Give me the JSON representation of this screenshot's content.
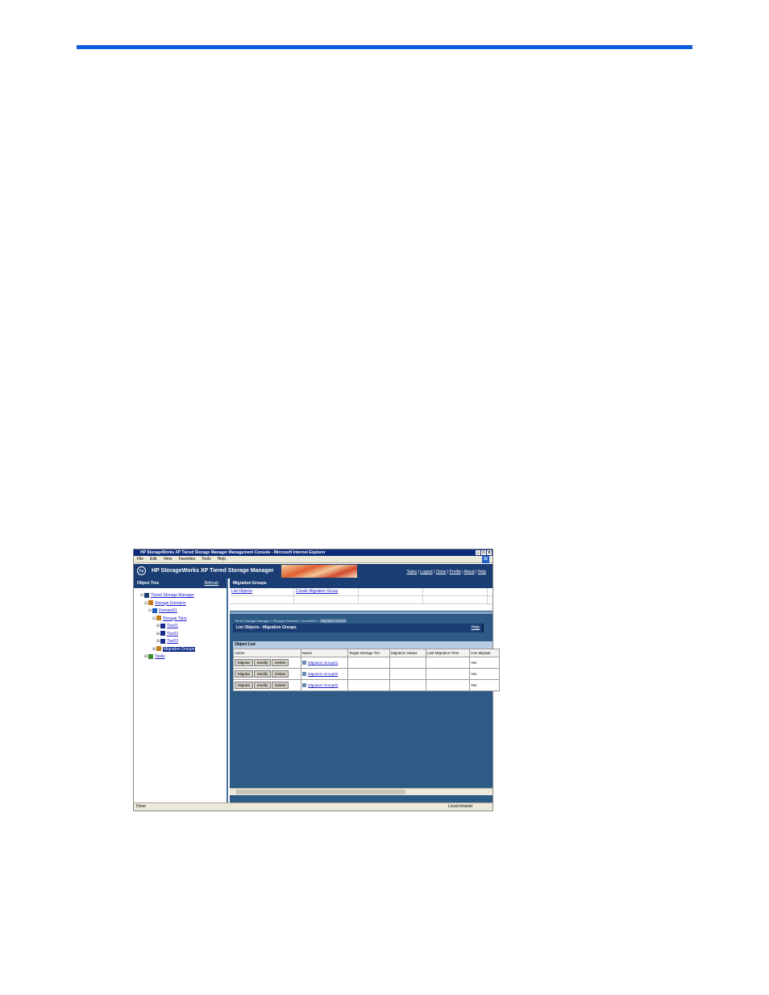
{
  "window": {
    "title": "HP StorageWorks XP Tiered Storage Manager Management Console - Microsoft Internet Explorer",
    "buttons": [
      "_",
      "□",
      "×"
    ]
  },
  "menu": [
    "File",
    "Edit",
    "View",
    "Favorites",
    "Tools",
    "Help"
  ],
  "header": {
    "title": "HP StorageWorks XP Tiered Storage Manager",
    "logo": "hp",
    "links": [
      "Tasks",
      "Logout",
      "Close",
      "Profile",
      "About",
      "Help"
    ]
  },
  "object_tree": {
    "title": "Object Tree",
    "refresh": "Refresh",
    "nodes": [
      {
        "label": "Tiered Storage Manager",
        "level": 0,
        "icon": "tsm-icon",
        "pm": "⊟"
      },
      {
        "label": "Storage Domains",
        "level": 1,
        "icon": "domains-icon",
        "pm": "⊟"
      },
      {
        "label": "Domain01",
        "level": 2,
        "icon": "domain-icon",
        "pm": "⊟"
      },
      {
        "label": "Storage Tiers",
        "level": 3,
        "icon": "tiers-icon",
        "pm": "⊟"
      },
      {
        "label": "Tier01",
        "level": 4,
        "icon": "tier-icon",
        "pm": "⊞"
      },
      {
        "label": "Tier02",
        "level": 4,
        "icon": "tier-icon",
        "pm": "⊞"
      },
      {
        "label": "Tier03",
        "level": 4,
        "icon": "tier-icon",
        "pm": "⊞"
      },
      {
        "label": "Migration Groups",
        "level": 3,
        "icon": "migration-groups-icon",
        "pm": "⊞",
        "selected": true
      },
      {
        "label": "Tasks",
        "level": 1,
        "icon": "tasks-icon",
        "pm": "⊞"
      }
    ]
  },
  "migration_groups_frame": {
    "title": "Migration Groups",
    "links": [
      "List Objects",
      "Create Migration Group"
    ]
  },
  "breadcrumb": {
    "items": [
      "Tiered Storage Manager",
      "Storage Domains",
      "Domain01"
    ],
    "current": "Migration Groups"
  },
  "list_bar": {
    "title": "List Objects - Migration Groups",
    "help": "Help"
  },
  "object_list": {
    "title": "Object List",
    "columns": [
      "Action",
      "Name",
      "Target Storage Tier",
      "Migration Status",
      "Last Migration Time",
      "Can Migrate"
    ],
    "buttons": [
      "Migrate",
      "Modify",
      "Delete"
    ],
    "rows": [
      {
        "name": "Migration Group01",
        "target": "",
        "status": "",
        "last": "",
        "can": "Yes"
      },
      {
        "name": "Migration Group02",
        "target": "",
        "status": "",
        "last": "",
        "can": "Yes"
      },
      {
        "name": "Migration Group03",
        "target": "",
        "status": "",
        "last": "",
        "can": "Yes"
      }
    ]
  },
  "statusbar": {
    "left": "Done",
    "zone": "Local intranet"
  },
  "colors": {
    "page_rule": "#0a5ed8",
    "header_bg": "#1a3d73",
    "content_bg": "#2e5b86",
    "link": "#1a1ac8"
  }
}
